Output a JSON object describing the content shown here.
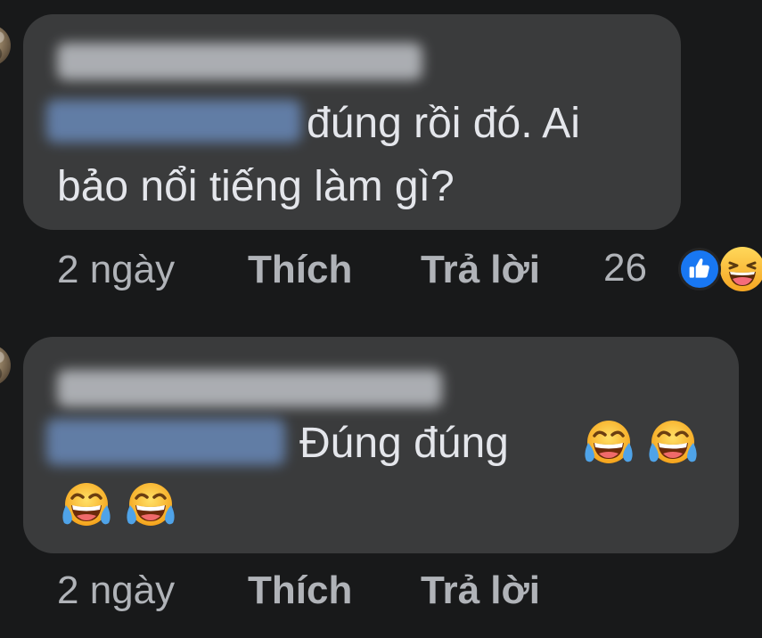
{
  "comments": [
    {
      "text_line1": "đúng rồi đó. Ai",
      "text_line2": "bảo nổi tiếng làm gì?",
      "time": "2 ngày",
      "like_label": "Thích",
      "reply_label": "Trả lời",
      "reaction_count": "26",
      "reaction_icons": [
        "like-icon",
        "haha-icon"
      ]
    },
    {
      "text_line1": "Đúng đúng",
      "emojis": [
        "face-with-tears-of-joy",
        "face-with-tears-of-joy",
        "face-with-tears-of-joy",
        "face-with-tears-of-joy"
      ],
      "time": "2 ngày",
      "like_label": "Thích",
      "reply_label": "Trả lời"
    }
  ],
  "colors": {
    "background": "#18191a",
    "bubble": "#3a3b3c",
    "text": "#e4e6eb",
    "meta": "#b0b3b8",
    "like_blue": "#1877f2"
  }
}
